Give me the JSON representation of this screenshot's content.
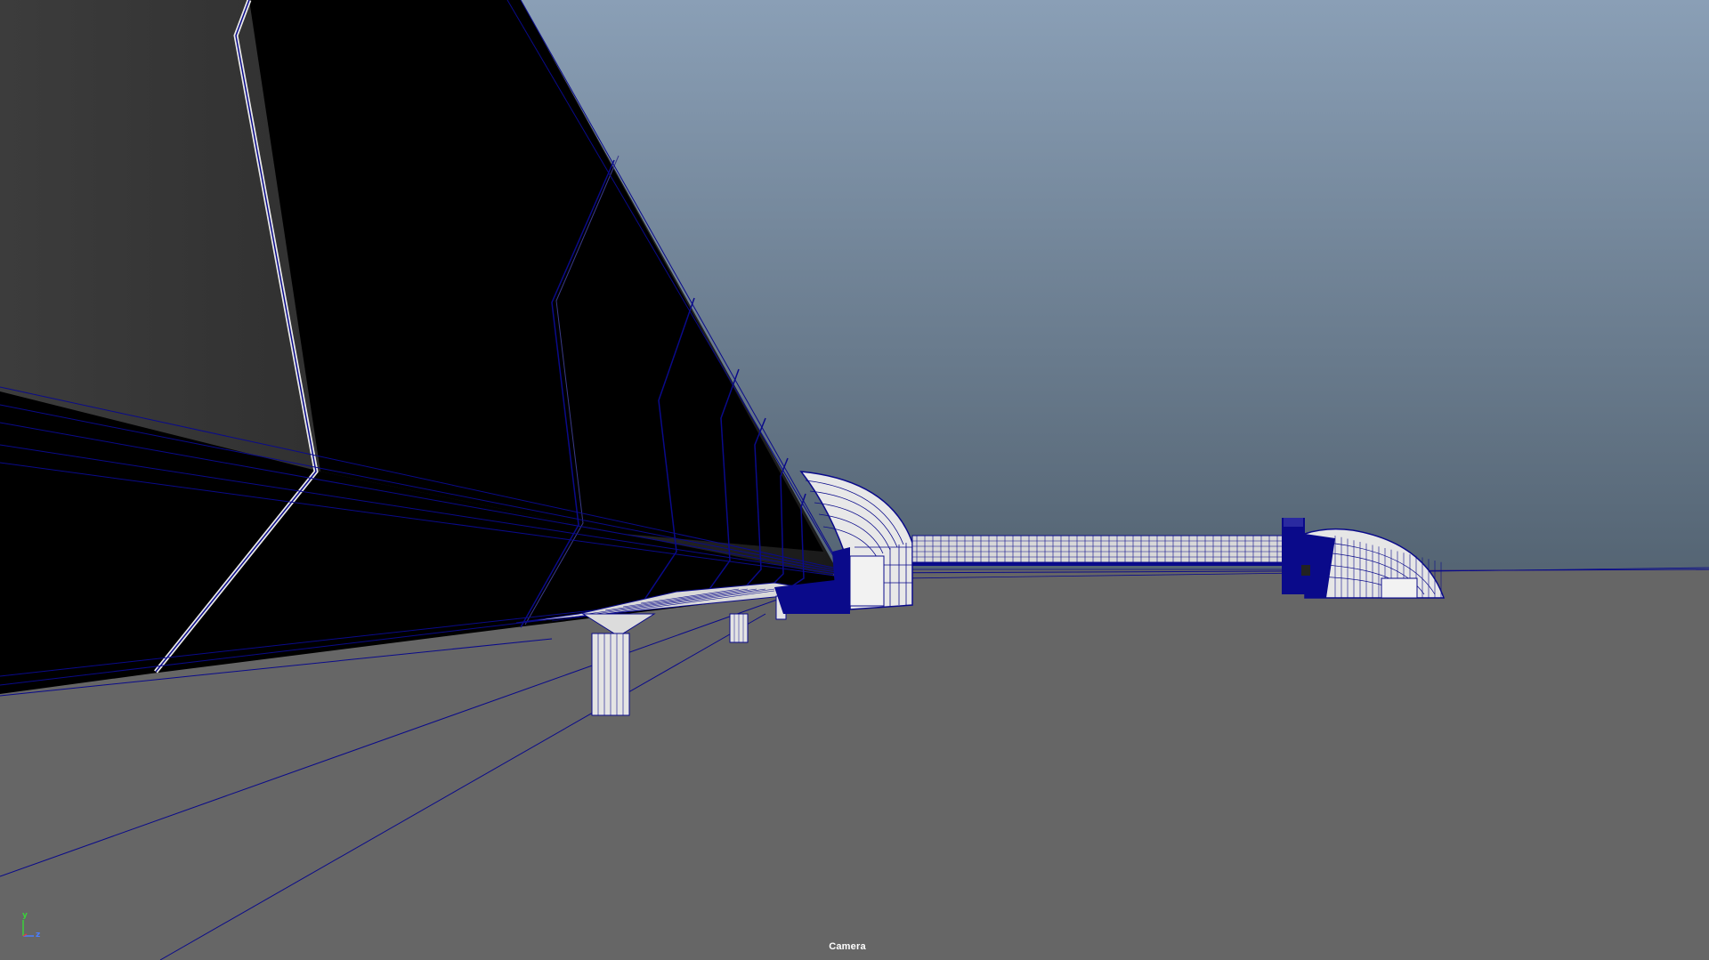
{
  "viewport": {
    "camera_label": "Camera",
    "axis_labels": {
      "y": "y",
      "z": "z"
    },
    "colors": {
      "sky_top": "#8a9fb6",
      "sky_bottom": "#546473",
      "ground": "#666666",
      "wireframe": "#0a0a8a",
      "dark_surface": "#000000",
      "mid_surface": "#3a3a3a",
      "highlight": "#e8e8e8",
      "axis_y": "#3ad13a",
      "axis_z": "#4a7dff",
      "axis_x": "#e04040"
    },
    "icons": [
      "view-axis-gizmo-icon"
    ]
  }
}
